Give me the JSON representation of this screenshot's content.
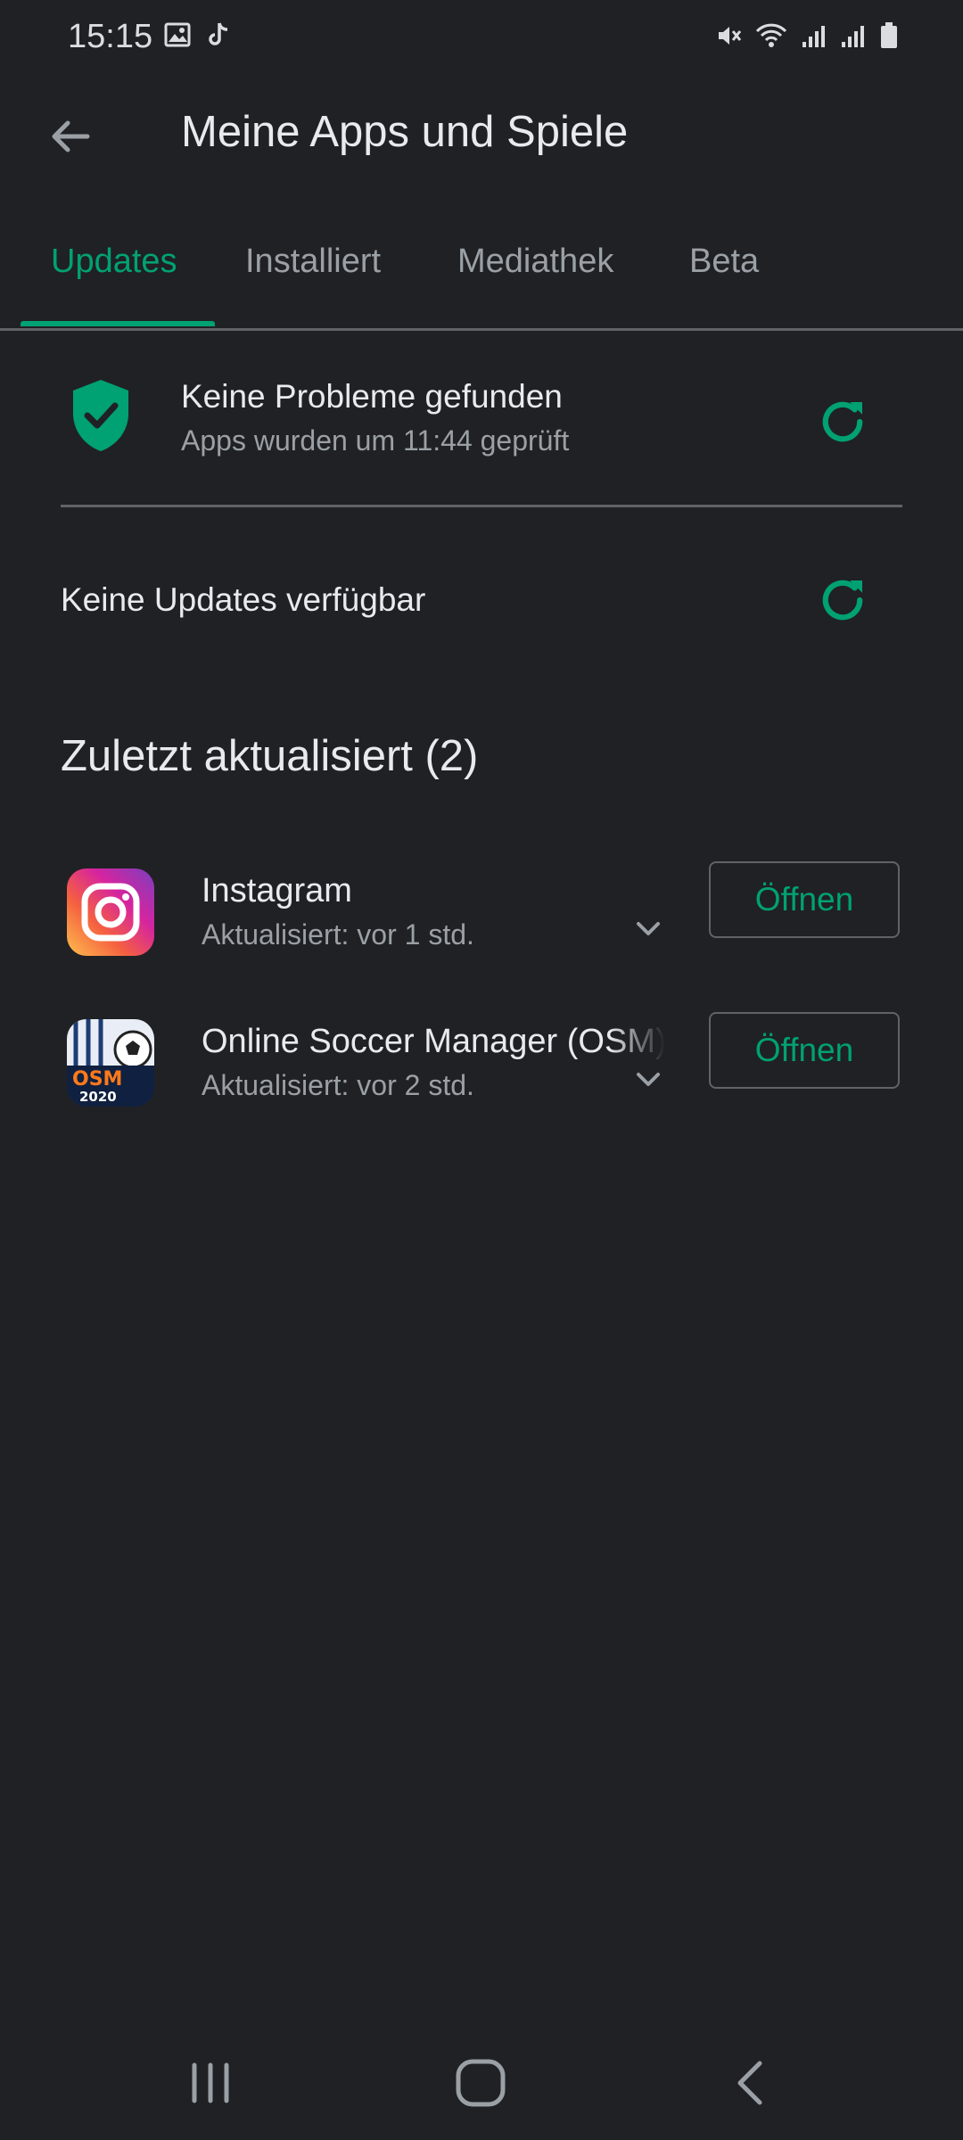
{
  "status_bar": {
    "time": "15:15",
    "left_icons": [
      "image-icon",
      "tiktok-icon"
    ],
    "right_icons": [
      "mute-icon",
      "wifi-icon",
      "signal-icon",
      "signal-roaming-icon",
      "battery-icon"
    ]
  },
  "app_bar": {
    "back_icon": "arrow-left-icon",
    "title": "Meine Apps und Spiele"
  },
  "tabs": [
    {
      "label": "Updates",
      "active": true
    },
    {
      "label": "Installiert",
      "active": false
    },
    {
      "label": "Mediathek",
      "active": false
    },
    {
      "label": "Beta",
      "active": false
    }
  ],
  "security": {
    "icon": "shield-check-icon",
    "title": "Keine Probleme gefunden",
    "subtitle": "Apps wurden um 11:44 geprüft"
  },
  "updates": {
    "label": "Keine Updates verfügbar"
  },
  "recent": {
    "header": "Zuletzt aktualisiert (2)",
    "apps": [
      {
        "name": "Instagram",
        "updated": "Aktualisiert: vor 1 std.",
        "button": "Öffnen",
        "icon": "instagram-icon"
      },
      {
        "name": "Online Soccer Manager (OSM)",
        "updated": "Aktualisiert: vor 2 std.",
        "button": "Öffnen",
        "icon": "osm-icon",
        "icon_text": "OSM",
        "icon_year": "2020"
      }
    ]
  },
  "nav_bar": {
    "icons": [
      "recents-icon",
      "home-icon",
      "back-icon"
    ]
  },
  "colors": {
    "background": "#202124",
    "accent": "#00a173",
    "text_primary": "#e8eaed",
    "text_secondary": "#9aa0a6",
    "divider": "#5f6368"
  }
}
